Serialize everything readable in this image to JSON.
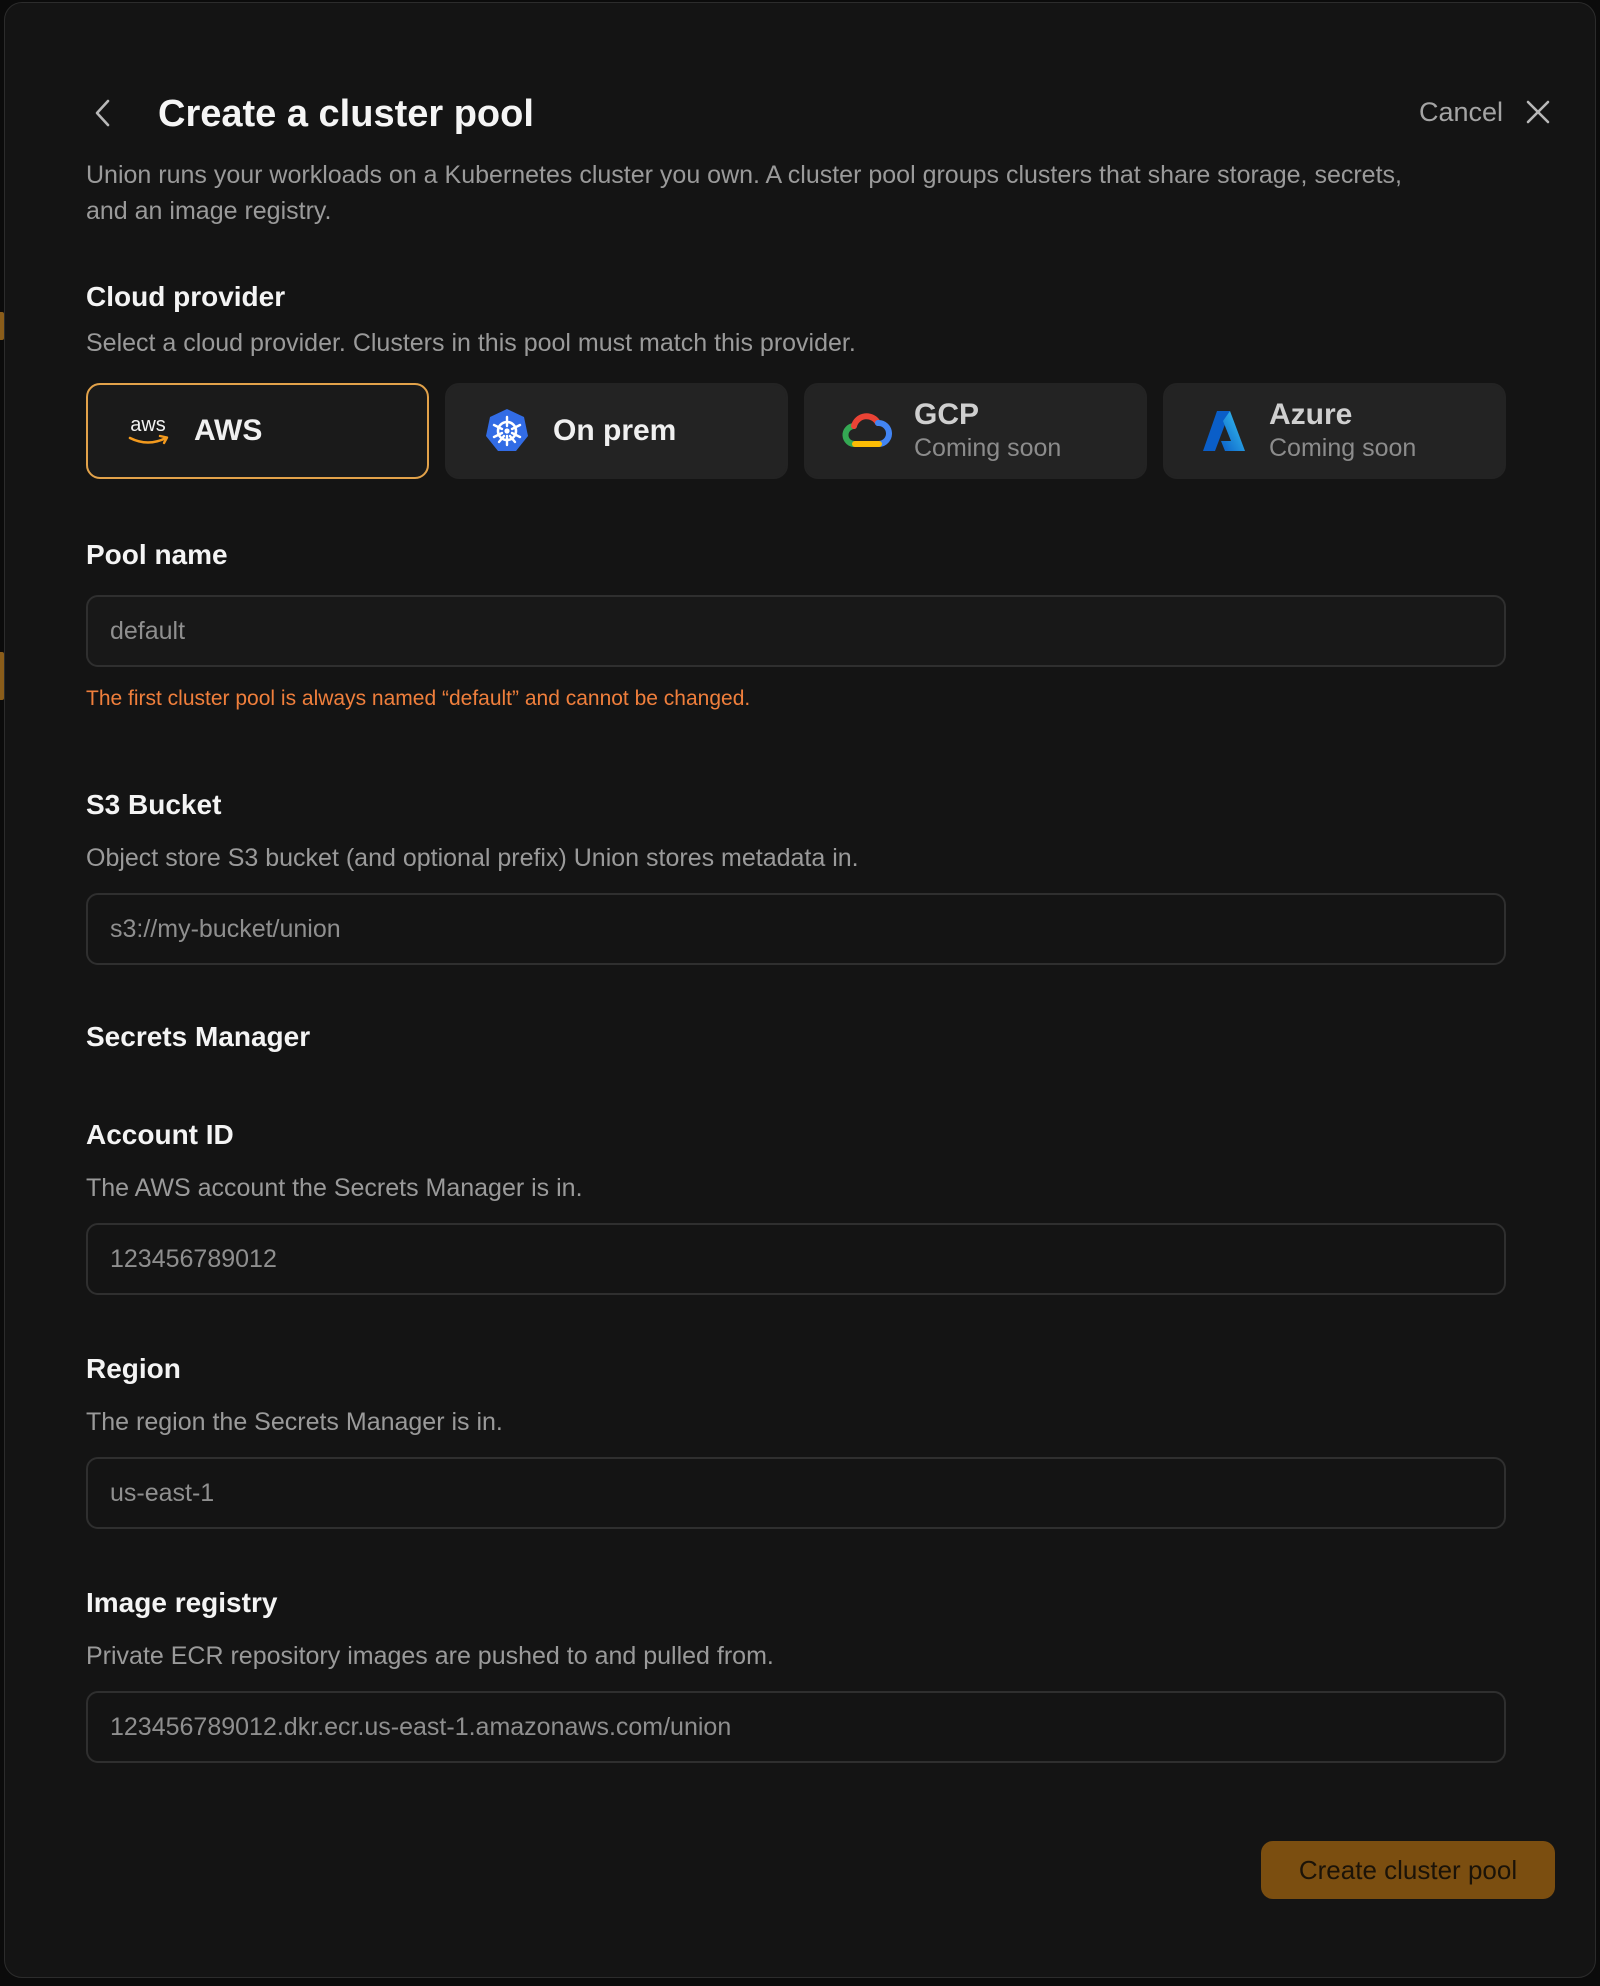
{
  "header": {
    "title": "Create a cluster pool",
    "cancel_label": "Cancel",
    "intro": "Union runs your workloads on a Kubernetes cluster you own. A cluster pool groups clusters that share storage, secrets, and an image registry."
  },
  "cloud_provider": {
    "label": "Cloud provider",
    "description": "Select a cloud provider. Clusters in this pool must match this provider.",
    "options": [
      {
        "name": "AWS",
        "subtitle": "",
        "icon": "aws-logo-icon",
        "selected": true
      },
      {
        "name": "On prem",
        "subtitle": "",
        "icon": "kubernetes-icon",
        "selected": false
      },
      {
        "name": "GCP",
        "subtitle": "Coming soon",
        "icon": "google-cloud-icon",
        "selected": false
      },
      {
        "name": "Azure",
        "subtitle": "Coming soon",
        "icon": "azure-icon",
        "selected": false
      }
    ],
    "selected_color": "#e2a24a"
  },
  "pool_name": {
    "label": "Pool name",
    "placeholder": "default",
    "warning": "The first cluster pool is always named “default” and cannot be changed.",
    "warning_color": "#f07f3c"
  },
  "s3_bucket": {
    "label": "S3 Bucket",
    "description": "Object store S3 bucket (and optional prefix) Union stores metadata in.",
    "placeholder": "s3://my-bucket/union"
  },
  "secrets_manager": {
    "section_label": "Secrets Manager",
    "account_id": {
      "label": "Account ID",
      "description": "The AWS account the Secrets Manager is in.",
      "placeholder": "123456789012"
    },
    "region": {
      "label": "Region",
      "description": "The region the Secrets Manager is in.",
      "placeholder": "us-east-1"
    }
  },
  "image_registry": {
    "label": "Image registry",
    "description": "Private ECR repository images are pushed to and pulled from.",
    "placeholder": "123456789012.dkr.ecr.us-east-1.amazonaws.com/union"
  },
  "footer": {
    "submit_label": "Create cluster pool",
    "submit_color": "#7b4e10"
  }
}
